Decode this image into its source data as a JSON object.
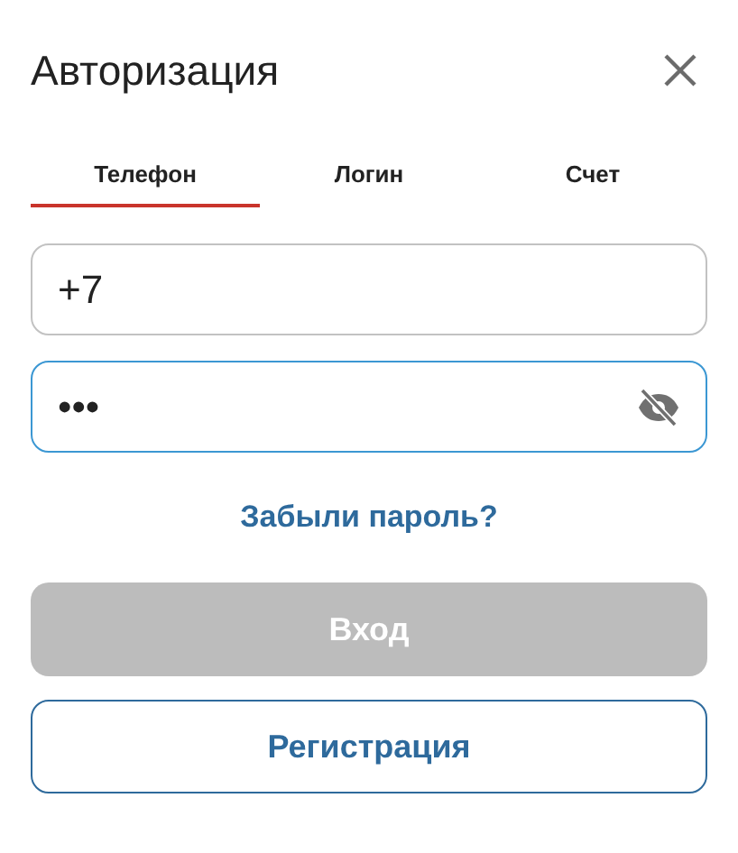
{
  "window": {
    "title": "Авторизация"
  },
  "tabs": [
    {
      "label": "Телефон",
      "selected": true
    },
    {
      "label": "Логин",
      "selected": false
    },
    {
      "label": "Счет",
      "selected": false
    }
  ],
  "phone_field": {
    "value": "+7",
    "focused": false
  },
  "password_field": {
    "value": "•••",
    "focused": true
  },
  "forgot_link": "Забыли пароль?",
  "login_button": {
    "label": "Вход",
    "disabled": true
  },
  "register_button": {
    "label": "Регистрация"
  }
}
